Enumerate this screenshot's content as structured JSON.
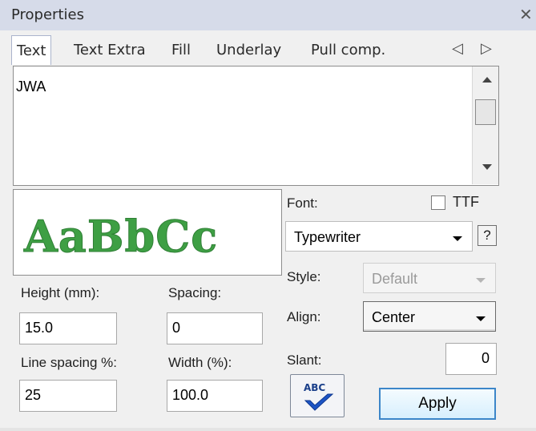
{
  "window": {
    "title": "Properties",
    "close_glyph": "✕"
  },
  "tabs": [
    {
      "label": "Text",
      "active": true
    },
    {
      "label": "Text Extra"
    },
    {
      "label": "Fill"
    },
    {
      "label": "Underlay"
    },
    {
      "label": "Pull comp."
    }
  ],
  "tab_scroll": {
    "left": "◁",
    "right": "▷"
  },
  "text_input": {
    "value": "JWA"
  },
  "preview": {
    "sample": "AaBbCc",
    "color": "#3e9f44"
  },
  "font": {
    "label": "Font:",
    "ttf_label": "TTF",
    "ttf_checked": false,
    "value": "Typewriter",
    "help_label": "?"
  },
  "style": {
    "label": "Style:",
    "value": "Default",
    "disabled": true
  },
  "align": {
    "label": "Align:",
    "value": "Center"
  },
  "slant": {
    "label": "Slant:",
    "value": "0"
  },
  "height": {
    "label": "Height (mm):",
    "value": "15.0"
  },
  "spacing": {
    "label": "Spacing:",
    "value": "0"
  },
  "line_spacing": {
    "label": "Line spacing %:",
    "value": "25"
  },
  "width": {
    "label": "Width (%):",
    "value": "100.0"
  },
  "spell_button": {
    "label": "ABC",
    "icon": "check-icon"
  },
  "apply_button": {
    "label": "Apply"
  }
}
